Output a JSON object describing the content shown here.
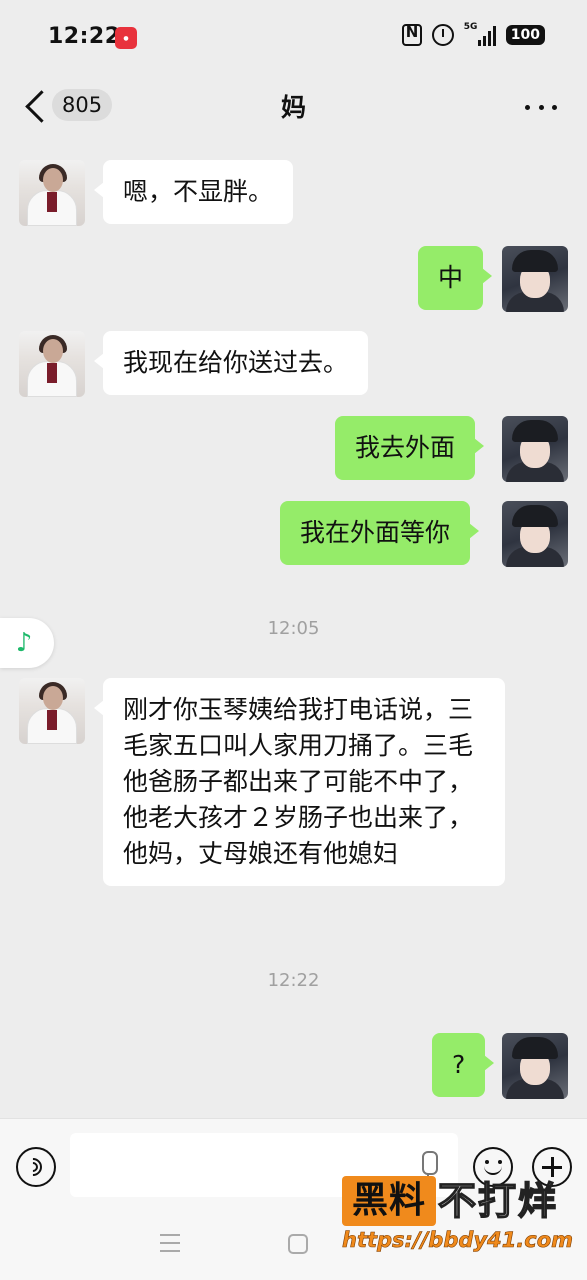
{
  "status_bar": {
    "time": "12:22",
    "app_icon": "news-app-icon",
    "network": "5G",
    "battery": "100"
  },
  "header": {
    "unread_count": "805",
    "title": "妈",
    "back_icon": "chevron-left-icon",
    "more_icon": "more-dots-icon"
  },
  "messages": [
    {
      "side": "left",
      "text": "嗯，不显胖。"
    },
    {
      "side": "right",
      "text": "中"
    },
    {
      "side": "left",
      "text": "我现在给你送过去。"
    },
    {
      "side": "right",
      "text": "我去外面"
    },
    {
      "side": "right",
      "text": "我在外面等你"
    },
    {
      "side": "left",
      "text": "刚才你玉琴姨给我打电话说，三毛家五口叫人家用刀捅了。三毛他爸肠子都出来了可能不中了，他老大孩才２岁肠子也出来了，他妈，丈母娘还有他媳妇"
    },
    {
      "side": "right",
      "text": "?"
    }
  ],
  "timestamps": [
    "12:05",
    "12:22"
  ],
  "music_float": {
    "icon": "music-note-icon",
    "glyph": "♪",
    "color": "#1db96a"
  },
  "input_bar": {
    "value": "",
    "voice_icon": "voice-icon",
    "mic_icon": "mic-icon",
    "emoji_icon": "emoji-icon",
    "plus_icon": "plus-icon"
  },
  "watermark": {
    "box_text": "黑料",
    "text": "不打烊",
    "url": "https://bbdy41.com"
  },
  "colors": {
    "background": "#ededed",
    "bubble_self": "#95ec69",
    "bubble_other": "#ffffff",
    "watermark_orange": "#f08a1c"
  }
}
